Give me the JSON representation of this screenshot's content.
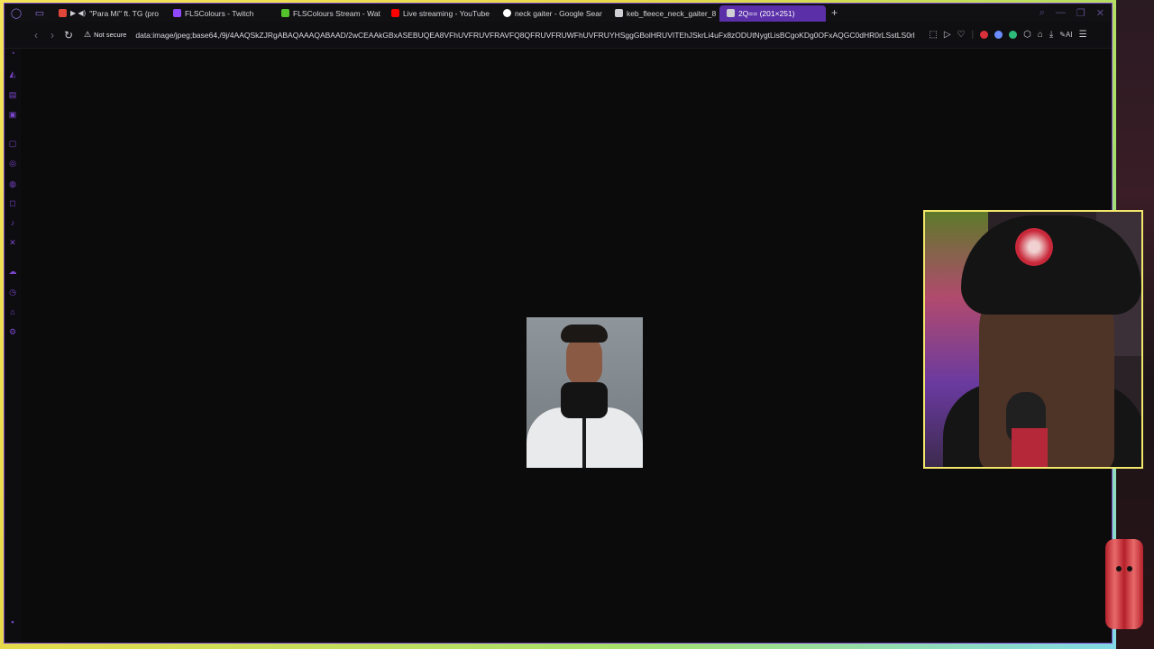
{
  "browser": {
    "tabs": [
      {
        "label": "\"Para Mí\" ft. TG (pro",
        "favicon_color": "#e0463a",
        "active": false
      },
      {
        "label": "FLSColours - Twitch",
        "favicon_color": "#9146ff",
        "active": false
      },
      {
        "label": "FLSColours Stream - Wat",
        "favicon_color": "#53c22b",
        "active": false
      },
      {
        "label": "Live streaming - YouTube",
        "favicon_color": "#ff0000",
        "active": false
      },
      {
        "label": "neck gaiter - Google Sear",
        "favicon_color": "#ffffff",
        "active": false
      },
      {
        "label": "keb_fleece_neck_gaiter_8",
        "favicon_color": "#cfcfd4",
        "active": false
      },
      {
        "label": "2Q== (201×251)",
        "favicon_color": "#cfcfd4",
        "active": true
      }
    ],
    "new_tab_label": "+",
    "security_label": "Not secure",
    "url": "data:image/jpeg;base64,/9j/4AAQSkZJRgABAQAAAQABAAD/2wCEAAkGBxASEBUQEA8VFhUVFRUVFRAVFQ8QFRUVFRUWFhUVFRUYHSggGBolHRUVITEhJSkrLi4uFx8zODUtNygtLisBCgoKDg0OFxAQGC0dHR0rLSstLS0rl",
    "ai_label": "AI"
  },
  "icons": {
    "back": "arrow-left-icon",
    "forward": "arrow-right-icon",
    "reload": "reload-icon",
    "warning": "warning-icon"
  },
  "colors": {
    "accent": "#7b46c7",
    "active_tab": "#5a2fa8",
    "cam_border": "#f2e76a"
  }
}
